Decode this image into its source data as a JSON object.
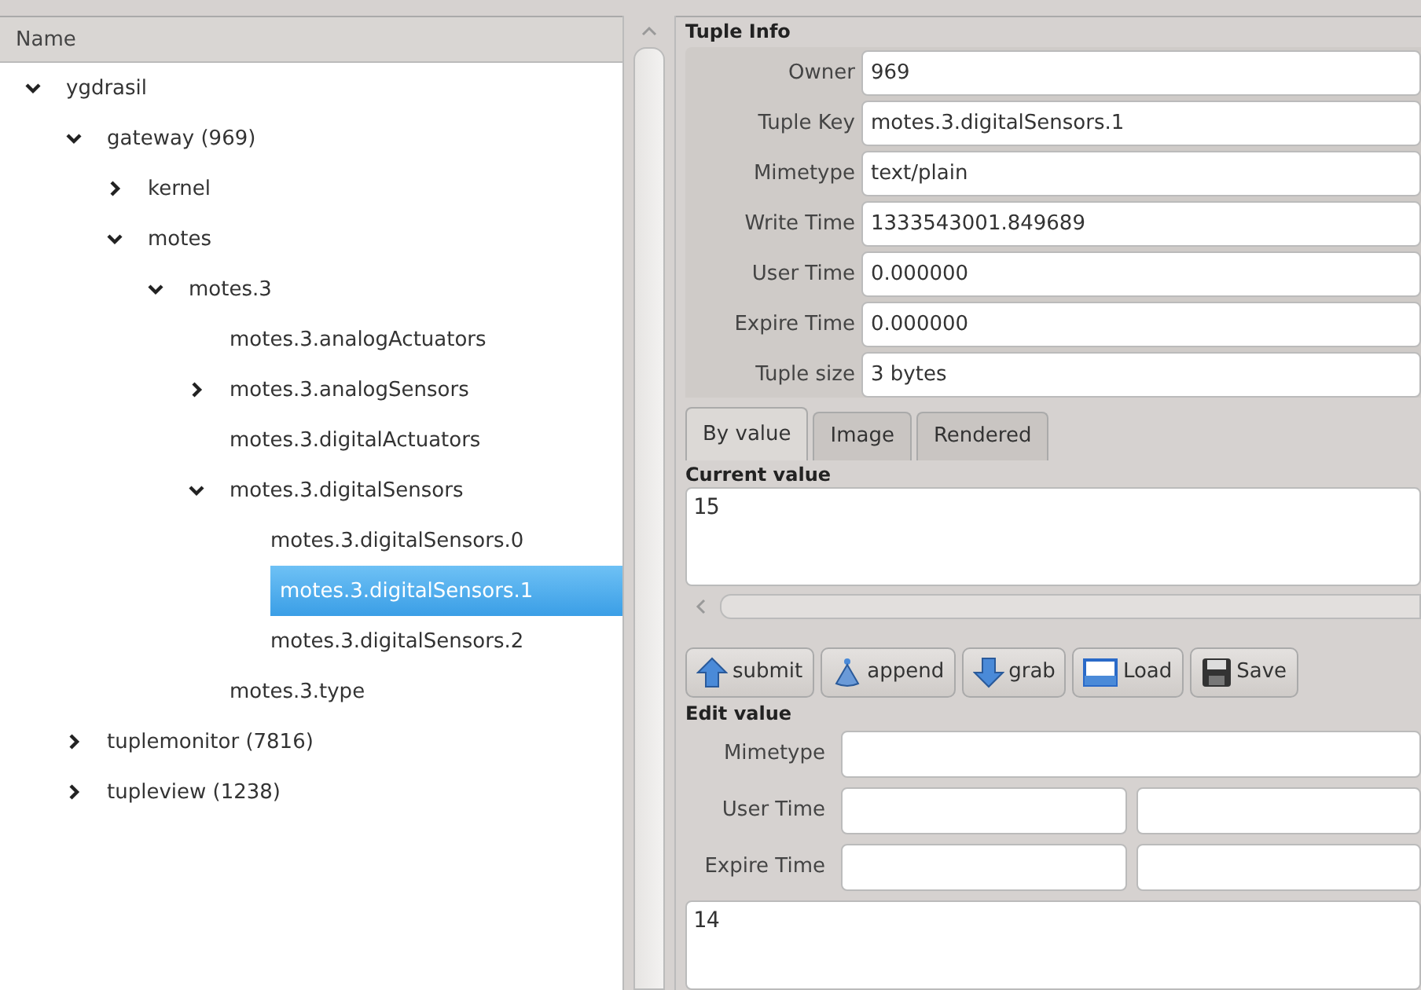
{
  "tree": {
    "column": "Name",
    "items": [
      {
        "label": "ygdrasil",
        "expanded": true,
        "selected": false,
        "children": [
          {
            "label": "gateway (969)",
            "expanded": true,
            "selected": false,
            "children": [
              {
                "label": "kernel",
                "expanded": false,
                "selected": false
              },
              {
                "label": "motes",
                "expanded": true,
                "selected": false,
                "children": [
                  {
                    "label": "motes.3",
                    "expanded": true,
                    "selected": false,
                    "children": [
                      {
                        "label": "motes.3.analogActuators",
                        "selected": false
                      },
                      {
                        "label": "motes.3.analogSensors",
                        "expanded": false,
                        "selected": false
                      },
                      {
                        "label": "motes.3.digitalActuators",
                        "selected": false
                      },
                      {
                        "label": "motes.3.digitalSensors",
                        "expanded": true,
                        "selected": false,
                        "children": [
                          {
                            "label": "motes.3.digitalSensors.0",
                            "selected": false
                          },
                          {
                            "label": "motes.3.digitalSensors.1",
                            "selected": true
                          },
                          {
                            "label": "motes.3.digitalSensors.2",
                            "selected": false
                          }
                        ]
                      },
                      {
                        "label": "motes.3.type",
                        "selected": false
                      }
                    ]
                  }
                ]
              }
            ]
          },
          {
            "label": "tuplemonitor (7816)",
            "expanded": false,
            "selected": false
          },
          {
            "label": "tupleview (1238)",
            "expanded": false,
            "selected": false
          }
        ]
      }
    ]
  },
  "tuple_info": {
    "title": "Tuple Info",
    "fields": [
      {
        "label": "Owner",
        "value": "969"
      },
      {
        "label": "Tuple Key",
        "value": "motes.3.digitalSensors.1"
      },
      {
        "label": "Mimetype",
        "value": "text/plain"
      },
      {
        "label": "Write Time",
        "value": "1333543001.849689"
      },
      {
        "label": "User Time",
        "value": "0.000000"
      },
      {
        "label": "Expire Time",
        "value": "0.000000"
      },
      {
        "label": "Tuple size",
        "value": "3 bytes"
      }
    ]
  },
  "tabs": [
    {
      "label": "By value",
      "selected": true
    },
    {
      "label": "Image",
      "selected": false
    },
    {
      "label": "Rendered",
      "selected": false
    }
  ],
  "current_value": {
    "title": "Current value",
    "value": "15"
  },
  "buttons": [
    {
      "label": "submit",
      "kind": "up"
    },
    {
      "label": "append",
      "kind": "cone"
    },
    {
      "label": "grab",
      "kind": "down"
    },
    {
      "label": "Load",
      "kind": "window"
    },
    {
      "label": "Save",
      "kind": "floppy"
    }
  ],
  "edit_value": {
    "title": "Edit value",
    "mimetype_label": "Mimetype",
    "user_time_label": "User Time",
    "expire_time_label": "Expire Time",
    "value": "14"
  }
}
